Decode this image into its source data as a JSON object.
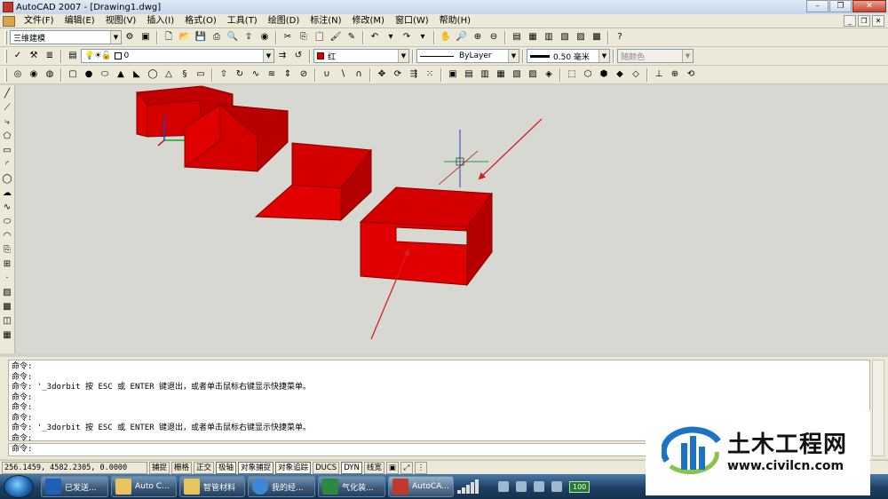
{
  "window": {
    "title": "AutoCAD 2007 - [Drawing1.dwg]",
    "controls": {
      "minimize": "–",
      "restore": "❐",
      "close": "✕"
    }
  },
  "menu": {
    "items": [
      "文件(F)",
      "编辑(E)",
      "视图(V)",
      "插入(I)",
      "格式(O)",
      "工具(T)",
      "绘图(D)",
      "标注(N)",
      "修改(M)",
      "窗口(W)",
      "帮助(H)"
    ]
  },
  "toolbar1": {
    "workspace": "三维建模"
  },
  "toolbar2": {
    "layer": "0",
    "color": "红",
    "linetype": "ByLayer",
    "lineweight": "0.50 毫米",
    "plotstyle": "随颜色"
  },
  "colors": {
    "solid_fill": "#d40000",
    "solid_edge": "#a00000",
    "drawing_bg": "#d8d8d2",
    "arrow": "#d42020"
  },
  "command": {
    "history": [
      "命令:",
      "命令:",
      "命令: '_3dorbit 按 ESC 或 ENTER 键退出，或者单击鼠标右键显示快捷菜单。",
      "命令:",
      "命令:",
      "命令:",
      "命令: '_3dorbit 按 ESC 或 ENTER 键退出，或者单击鼠标右键显示快捷菜单。",
      "命令:"
    ],
    "prompt": "命令:"
  },
  "status": {
    "coordinates": "256.1459,  4582.2305, 0.0000",
    "toggles": [
      "捕捉",
      "栅格",
      "正交",
      "极轴",
      "对象捕捉",
      "对象追踪",
      "DUCS",
      "DYN",
      "线宽"
    ]
  },
  "taskbar": {
    "tasks": [
      {
        "label": "已发送...",
        "icon": "outlook"
      },
      {
        "label": "Auto C...",
        "icon": "folder"
      },
      {
        "label": "智管材料",
        "icon": "folder"
      },
      {
        "label": "我的经...",
        "icon": "ie"
      },
      {
        "label": "气化装...",
        "icon": "excel"
      },
      {
        "label": "AutoCA...",
        "icon": "acad"
      }
    ],
    "battery": "100"
  },
  "watermark": {
    "brand": "土木工程网",
    "url": "www.civilcn.com"
  }
}
